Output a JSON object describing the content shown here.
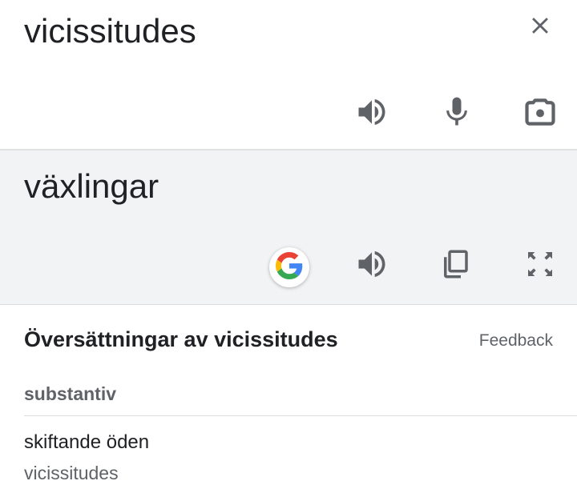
{
  "source": {
    "text": "vicissitudes",
    "icons": [
      "close-icon",
      "speaker-icon",
      "microphone-icon",
      "camera-lens-icon"
    ]
  },
  "target": {
    "text": "växlingar",
    "icons": [
      "google-icon",
      "speaker-icon",
      "copy-icon",
      "fullscreen-icon"
    ]
  },
  "translations": {
    "heading": "Översättningar av vicissitudes",
    "feedback_label": "Feedback",
    "part_of_speech": "substantiv",
    "entries": [
      {
        "word": "skiftande öden",
        "back_translation": "vicissitudes"
      }
    ]
  },
  "colors": {
    "icon_gray": "#5f6368",
    "target_bg": "#f1f3f4",
    "google_blue": "#4285F4",
    "google_red": "#EA4335",
    "google_yellow": "#FBBC05",
    "google_green": "#34A853"
  }
}
